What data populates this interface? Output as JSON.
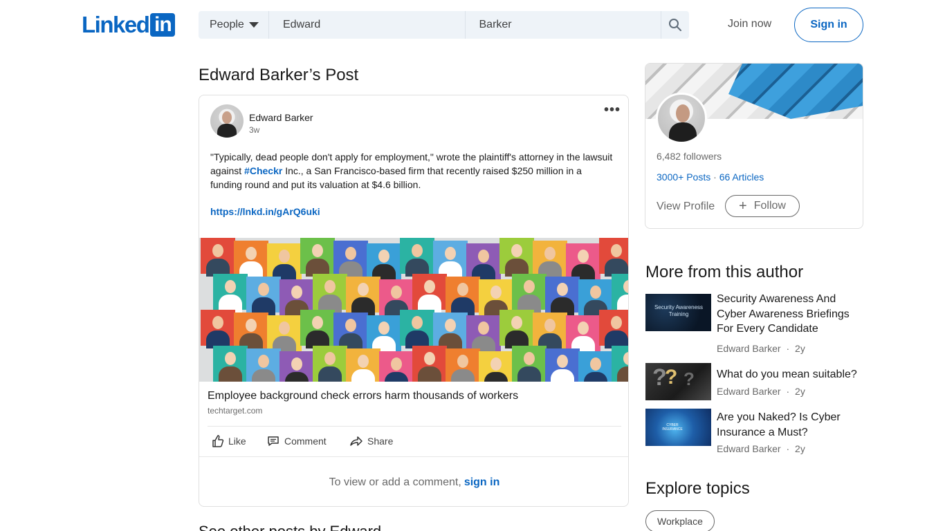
{
  "header": {
    "logo_text": "Linked",
    "logo_box": "in",
    "search": {
      "dropdown_label": "People",
      "first_name": "Edward",
      "last_name": "Barker"
    },
    "join_label": "Join now",
    "signin_label": "Sign in"
  },
  "post": {
    "page_title": "Edward Barker’s Post",
    "author": "Edward Barker",
    "time": "3w",
    "more_label": "•••",
    "text_before": "\"Typically, dead people don't apply for employment,\" wrote the plaintiff's attorney in the lawsuit against ",
    "hashtag": "#Checkr",
    "text_after": " Inc., a San Francisco-based firm that recently raised $250 million in a funding round and put its valuation at $4.6 billion.",
    "link": "https://lnkd.in/gArQ6uki",
    "article_title": "Employee background check errors harm thousands of workers",
    "article_domain": "techtarget.com",
    "actions": {
      "like": "Like",
      "comment": "Comment",
      "share": "Share"
    },
    "comment_prompt": "To view or add a comment,",
    "comment_signin": "sign in"
  },
  "more_posts_heading": "See other posts by Edward",
  "profile": {
    "followers": "6,482 followers",
    "posts": "3000+ Posts",
    "dot": "·",
    "articles": "66 Articles",
    "view_profile": "View Profile",
    "follow_plus": "+",
    "follow_label": "Follow"
  },
  "more_from_author": {
    "heading": "More from this author",
    "items": [
      {
        "title": "Security Awareness And Cyber Awareness Briefings For Every Candidate",
        "author": "Edward Barker",
        "sep": "·",
        "age": "2y",
        "thumb_text": "Security Awareness Training"
      },
      {
        "title": "What do you mean suitable?",
        "author": "Edward Barker",
        "sep": "·",
        "age": "2y"
      },
      {
        "title": "Are you Naked? Is Cyber Insurance a Must?",
        "author": "Edward Barker",
        "sep": "·",
        "age": "2y",
        "thumb_text": "CYBER INSURANCE"
      }
    ]
  },
  "explore": {
    "heading": "Explore topics",
    "topics": [
      "Workplace"
    ]
  },
  "colors": {
    "brand": "#0a66c2",
    "search_bg": "#eef3f8"
  }
}
